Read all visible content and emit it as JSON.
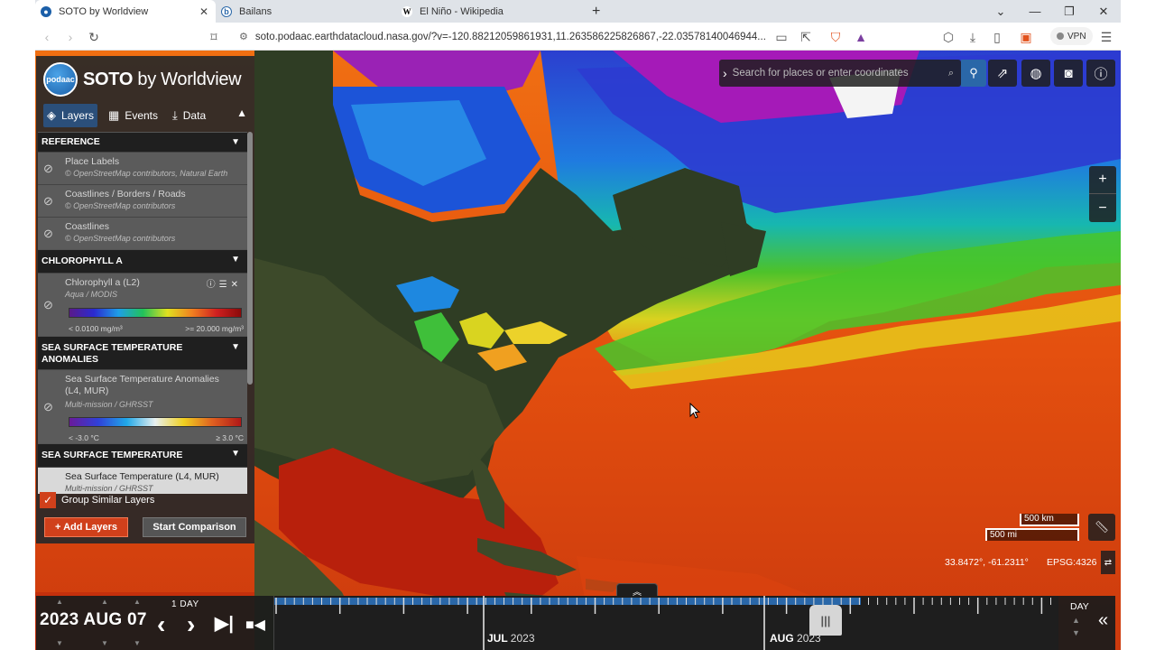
{
  "browser": {
    "tabs": [
      {
        "title": "SOTO by Worldview",
        "active": true
      },
      {
        "title": "Bailans",
        "active": false
      },
      {
        "title": "El Niño - Wikipedia",
        "active": false
      }
    ],
    "new_tab": "+",
    "url": "soto.podaac.earthdatacloud.nasa.gov/?v=-120.88212059861931,11.263586225826867,-22.03578140046944...",
    "vpn_label": "VPN"
  },
  "app": {
    "logo_text": "podaac",
    "title_main": "SOTO",
    "title_rest": "by Worldview",
    "tabs": [
      {
        "label": "Layers",
        "icon": "layers-icon"
      },
      {
        "label": "Events",
        "icon": "calendar-icon"
      },
      {
        "label": "Data",
        "icon": "download-icon"
      }
    ]
  },
  "layers": {
    "groups": [
      {
        "title": "REFERENCE",
        "items": [
          {
            "name": "Place Labels",
            "source": "© OpenStreetMap contributors, Natural Earth"
          },
          {
            "name": "Coastlines / Borders / Roads",
            "source": "© OpenStreetMap contributors"
          },
          {
            "name": "Coastlines",
            "source": "© OpenStreetMap contributors"
          }
        ]
      },
      {
        "title": "CHLOROPHYLL A",
        "items": [
          {
            "name": "Chlorophyll a (L2)",
            "source": "Aqua / MODIS",
            "legend_low": "< 0.0100 mg/m³",
            "legend_high": ">= 20.000 mg/m³"
          }
        ]
      },
      {
        "title_line1": "SEA SURFACE TEMPERATURE",
        "title_line2": "ANOMALIES",
        "items": [
          {
            "name_line1": "Sea Surface Temperature Anomalies",
            "name_line2": "(L4, MUR)",
            "source": "Multi-mission / GHRSST",
            "legend_low": "< -3.0 °C",
            "legend_high": "≥ 3.0 °C"
          }
        ]
      },
      {
        "title": "SEA SURFACE TEMPERATURE",
        "items": [
          {
            "name": "Sea Surface Temperature (L4, MUR)",
            "source": "Multi-mission / GHRSST"
          }
        ]
      }
    ],
    "group_similar_label": "Group Similar Layers",
    "add_layers_label": "+ Add Layers",
    "start_comparison_label": "Start Comparison"
  },
  "map": {
    "search_placeholder": "Search for places or enter coordinates",
    "scale_km": "500 km",
    "scale_mi": "500 mi",
    "coordinates": "33.8472°, -61.2311°",
    "projection": "EPSG:4326",
    "zoom_in": "+",
    "zoom_out": "−"
  },
  "timeline": {
    "date": "2023 AUG 07",
    "interval": "1  DAY",
    "month1": "JUL",
    "year1": "2023",
    "month2": "AUG",
    "year2": "2023",
    "zoom_level": "DAY"
  },
  "colors": {
    "accent": "#d0401b",
    "primary_blue": "#2a67a8"
  }
}
